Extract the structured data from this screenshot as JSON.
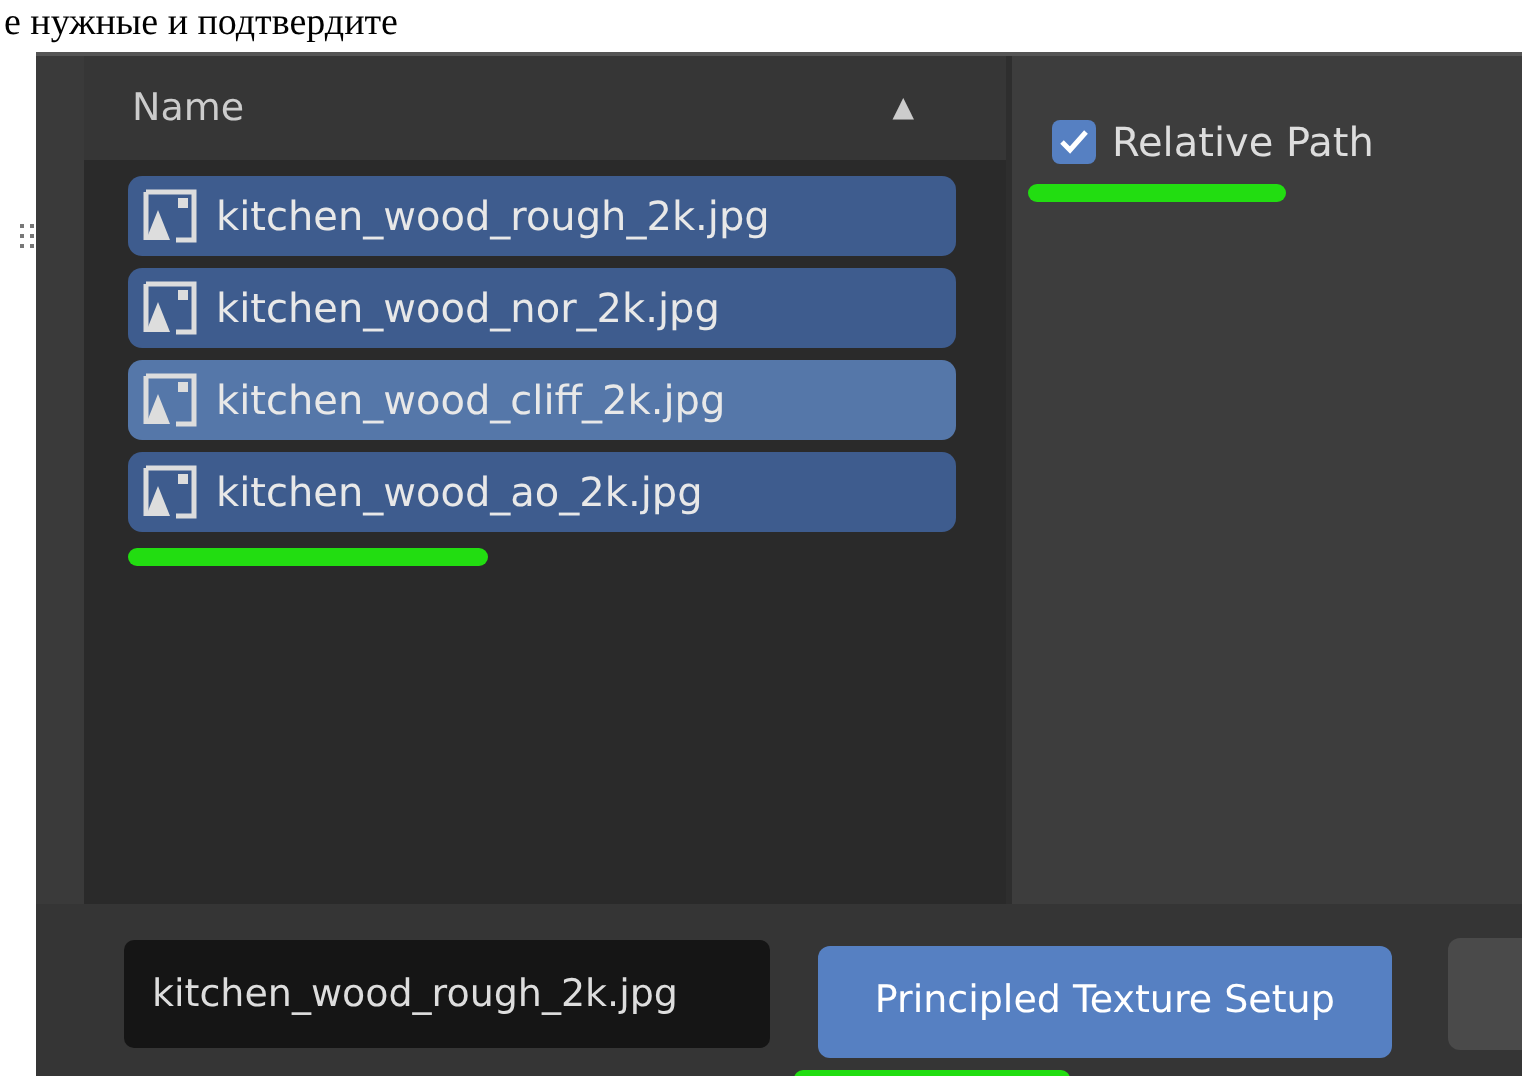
{
  "caption": "е нужные и подтвердите",
  "file_list": {
    "column": "Name",
    "sort_indicator": "▲",
    "files": [
      {
        "name": "kitchen_wood_rough_2k.jpg",
        "selected": true,
        "highlighted": false
      },
      {
        "name": "kitchen_wood_nor_2k.jpg",
        "selected": true,
        "highlighted": false
      },
      {
        "name": "kitchen_wood_cliff_2k.jpg",
        "selected": true,
        "highlighted": true
      },
      {
        "name": "kitchen_wood_ao_2k.jpg",
        "selected": true,
        "highlighted": false
      }
    ]
  },
  "options": {
    "relative_path": {
      "label": "Relative Path",
      "checked": true
    }
  },
  "footer": {
    "filename": "kitchen_wood_rough_2k.jpg",
    "confirm_button": "Principled Texture Setup"
  }
}
